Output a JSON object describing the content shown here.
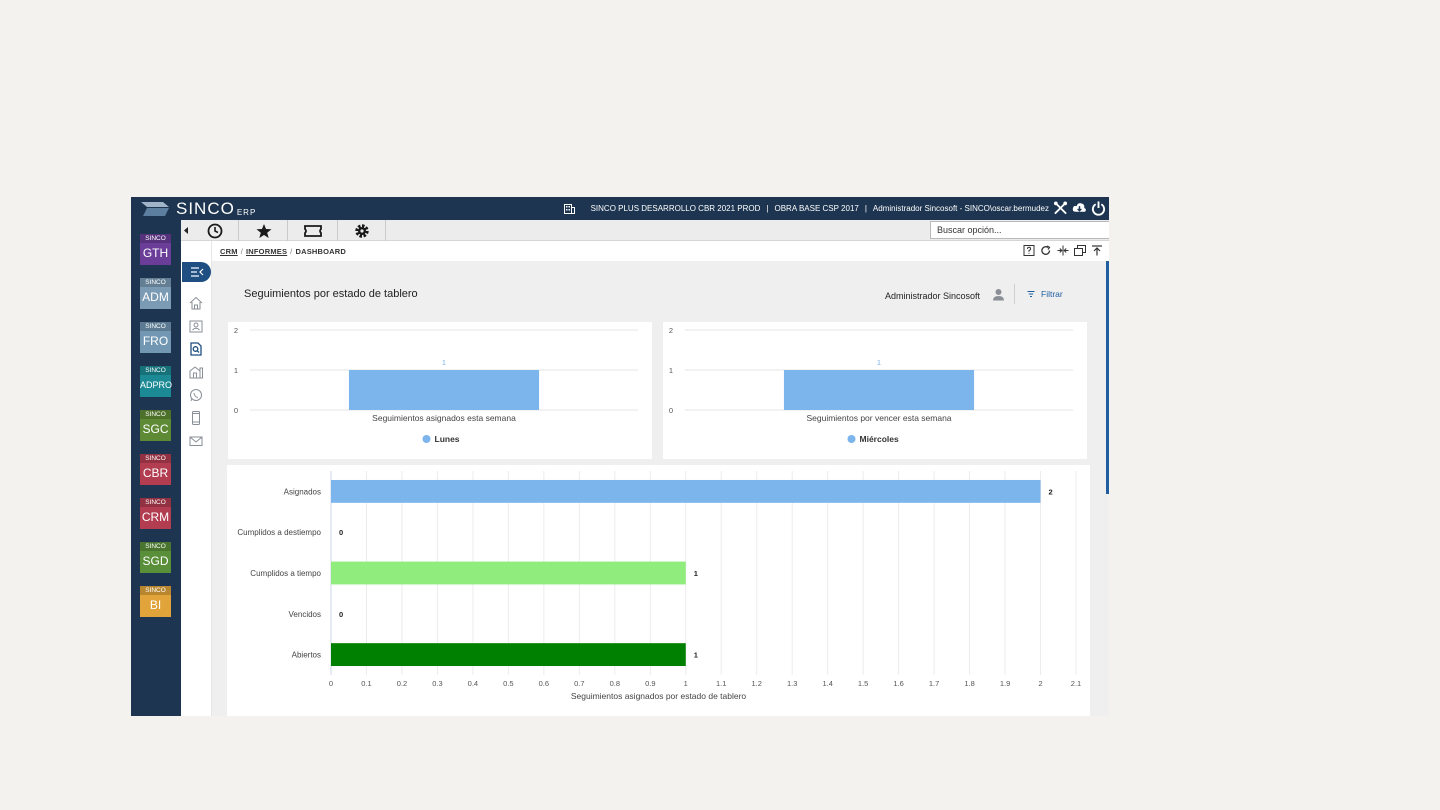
{
  "topbar": {
    "brand": "SINCO",
    "brand_sub": "ERP",
    "company": "SINCO PLUS DESARROLLO CBR 2021 PROD",
    "project": "OBRA BASE CSP 2017",
    "user": "Administrador Sincosoft - SINCO\\oscar.bermudez",
    "separator": "|"
  },
  "modules": [
    {
      "top": "SINCO",
      "code": "GTH",
      "color": "#6a3e98"
    },
    {
      "top": "SINCO",
      "code": "ADM",
      "color": "#7b9bb5"
    },
    {
      "top": "SINCO",
      "code": "FRO",
      "color": "#7197b3"
    },
    {
      "top": "SINCO",
      "code": "ADPRO",
      "color": "#1b8a94"
    },
    {
      "top": "SINCO",
      "code": "SGC",
      "color": "#5f8a35"
    },
    {
      "top": "SINCO",
      "code": "CBR",
      "color": "#b23c50"
    },
    {
      "top": "SINCO",
      "code": "CRM",
      "color": "#b23c50"
    },
    {
      "top": "SINCO",
      "code": "SGD",
      "color": "#5a8f3a"
    },
    {
      "top": "SINCO",
      "code": "BI",
      "color": "#e0a43a"
    }
  ],
  "toolbar": {
    "search_placeholder": "Buscar opción..."
  },
  "breadcrumb": {
    "items": [
      "CRM",
      "INFORMES",
      "DASHBOARD"
    ],
    "separator": "/"
  },
  "dashboard": {
    "title": "Seguimientos por estado de tablero",
    "user": "Administrador Sincosoft",
    "filter_label": "Filtrar"
  },
  "colors": {
    "navy": "#1d3550",
    "accent_blue": "#1f5fa0",
    "bar_blue": "#7cb5ec",
    "bar_lightgreen": "#90ed7d",
    "bar_green": "#008000"
  },
  "chart_data": [
    {
      "type": "bar",
      "categories": [
        "Seguimientos asignados esta semana"
      ],
      "series": [
        {
          "name": "Lunes",
          "values": [
            1
          ]
        }
      ],
      "ylim": [
        0,
        2
      ],
      "yticks": [
        "0",
        "1",
        "2"
      ],
      "data_labels": [
        "1"
      ],
      "legend": "bottom",
      "grid": true
    },
    {
      "type": "bar",
      "categories": [
        "Seguimientos por vencer esta semana"
      ],
      "series": [
        {
          "name": "Miércoles",
          "values": [
            1
          ]
        }
      ],
      "ylim": [
        0,
        2
      ],
      "yticks": [
        "0",
        "1",
        "2"
      ],
      "data_labels": [
        "1"
      ],
      "legend": "bottom",
      "grid": true
    },
    {
      "type": "bar",
      "orientation": "horizontal",
      "categories": [
        "Asignados",
        "Cumplidos a destiempo",
        "Cumplidos a tiempo",
        "Vencidos",
        "Abiertos"
      ],
      "values": [
        2,
        0,
        1,
        0,
        1
      ],
      "data_labels": [
        "2",
        "0",
        "1",
        "0",
        "1"
      ],
      "colors": [
        "#7cb5ec",
        "#7cb5ec",
        "#90ed7d",
        "#7cb5ec",
        "#008000"
      ],
      "xlabel": "Seguimientos asignados por estado de tablero",
      "xlim": [
        0,
        2.1
      ],
      "xticks": [
        "0",
        "0.1",
        "0.2",
        "0.3",
        "0.4",
        "0.5",
        "0.6",
        "0.7",
        "0.8",
        "0.9",
        "1",
        "1.1",
        "1.2",
        "1.3",
        "1.4",
        "1.5",
        "1.6",
        "1.7",
        "1.8",
        "1.9",
        "2",
        "2.1"
      ],
      "grid": true
    }
  ]
}
